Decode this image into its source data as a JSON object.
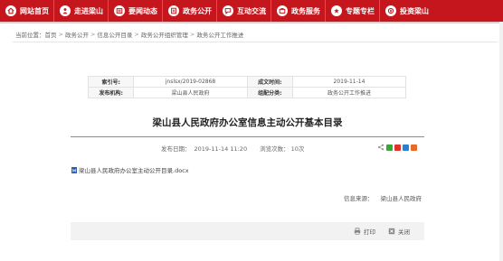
{
  "colors": {
    "nav_bg": "#c4161c",
    "accent": "#c4161c"
  },
  "nav": [
    {
      "label": "网站首页",
      "icon": "home-icon"
    },
    {
      "label": "走进梁山",
      "icon": "person-icon"
    },
    {
      "label": "要闻动态",
      "icon": "news-icon"
    },
    {
      "label": "政务公开",
      "icon": "open-icon"
    },
    {
      "label": "互动交流",
      "icon": "chat-icon"
    },
    {
      "label": "政务服务",
      "icon": "service-icon"
    },
    {
      "label": "专题专栏",
      "icon": "topic-icon"
    },
    {
      "label": "投资梁山",
      "icon": "invest-icon"
    }
  ],
  "breadcrumb": {
    "prefix": "当前位置：",
    "items": [
      "首页",
      "政务公开",
      "信息公开目录",
      "政务公开组织管理",
      "政务公开工作推进"
    ]
  },
  "info": {
    "index_label": "索引号:",
    "index_value": "jnslsx/2019-02868",
    "date_label": "成文时间:",
    "date_value": "2019-11-14",
    "org_label": "发布机构:",
    "org_value": "梁山县人民政府",
    "category_label": "组配分类:",
    "category_value": "政务公开工作推进"
  },
  "title": "梁山县人民政府办公室信息主动公开基本目录",
  "meta": {
    "publish_label": "发布日期：",
    "publish_value": "2019-11-14 11:20",
    "views_label": "浏览次数：",
    "views_value": "10次"
  },
  "attachment": {
    "name": "梁山县人民政府办公室主动公开目录.docx",
    "icon": "word-file-icon"
  },
  "source": {
    "label": "信息来源：",
    "value": "梁山县人民政府"
  },
  "footer": {
    "print_label": "打印",
    "close_label": "关闭"
  }
}
